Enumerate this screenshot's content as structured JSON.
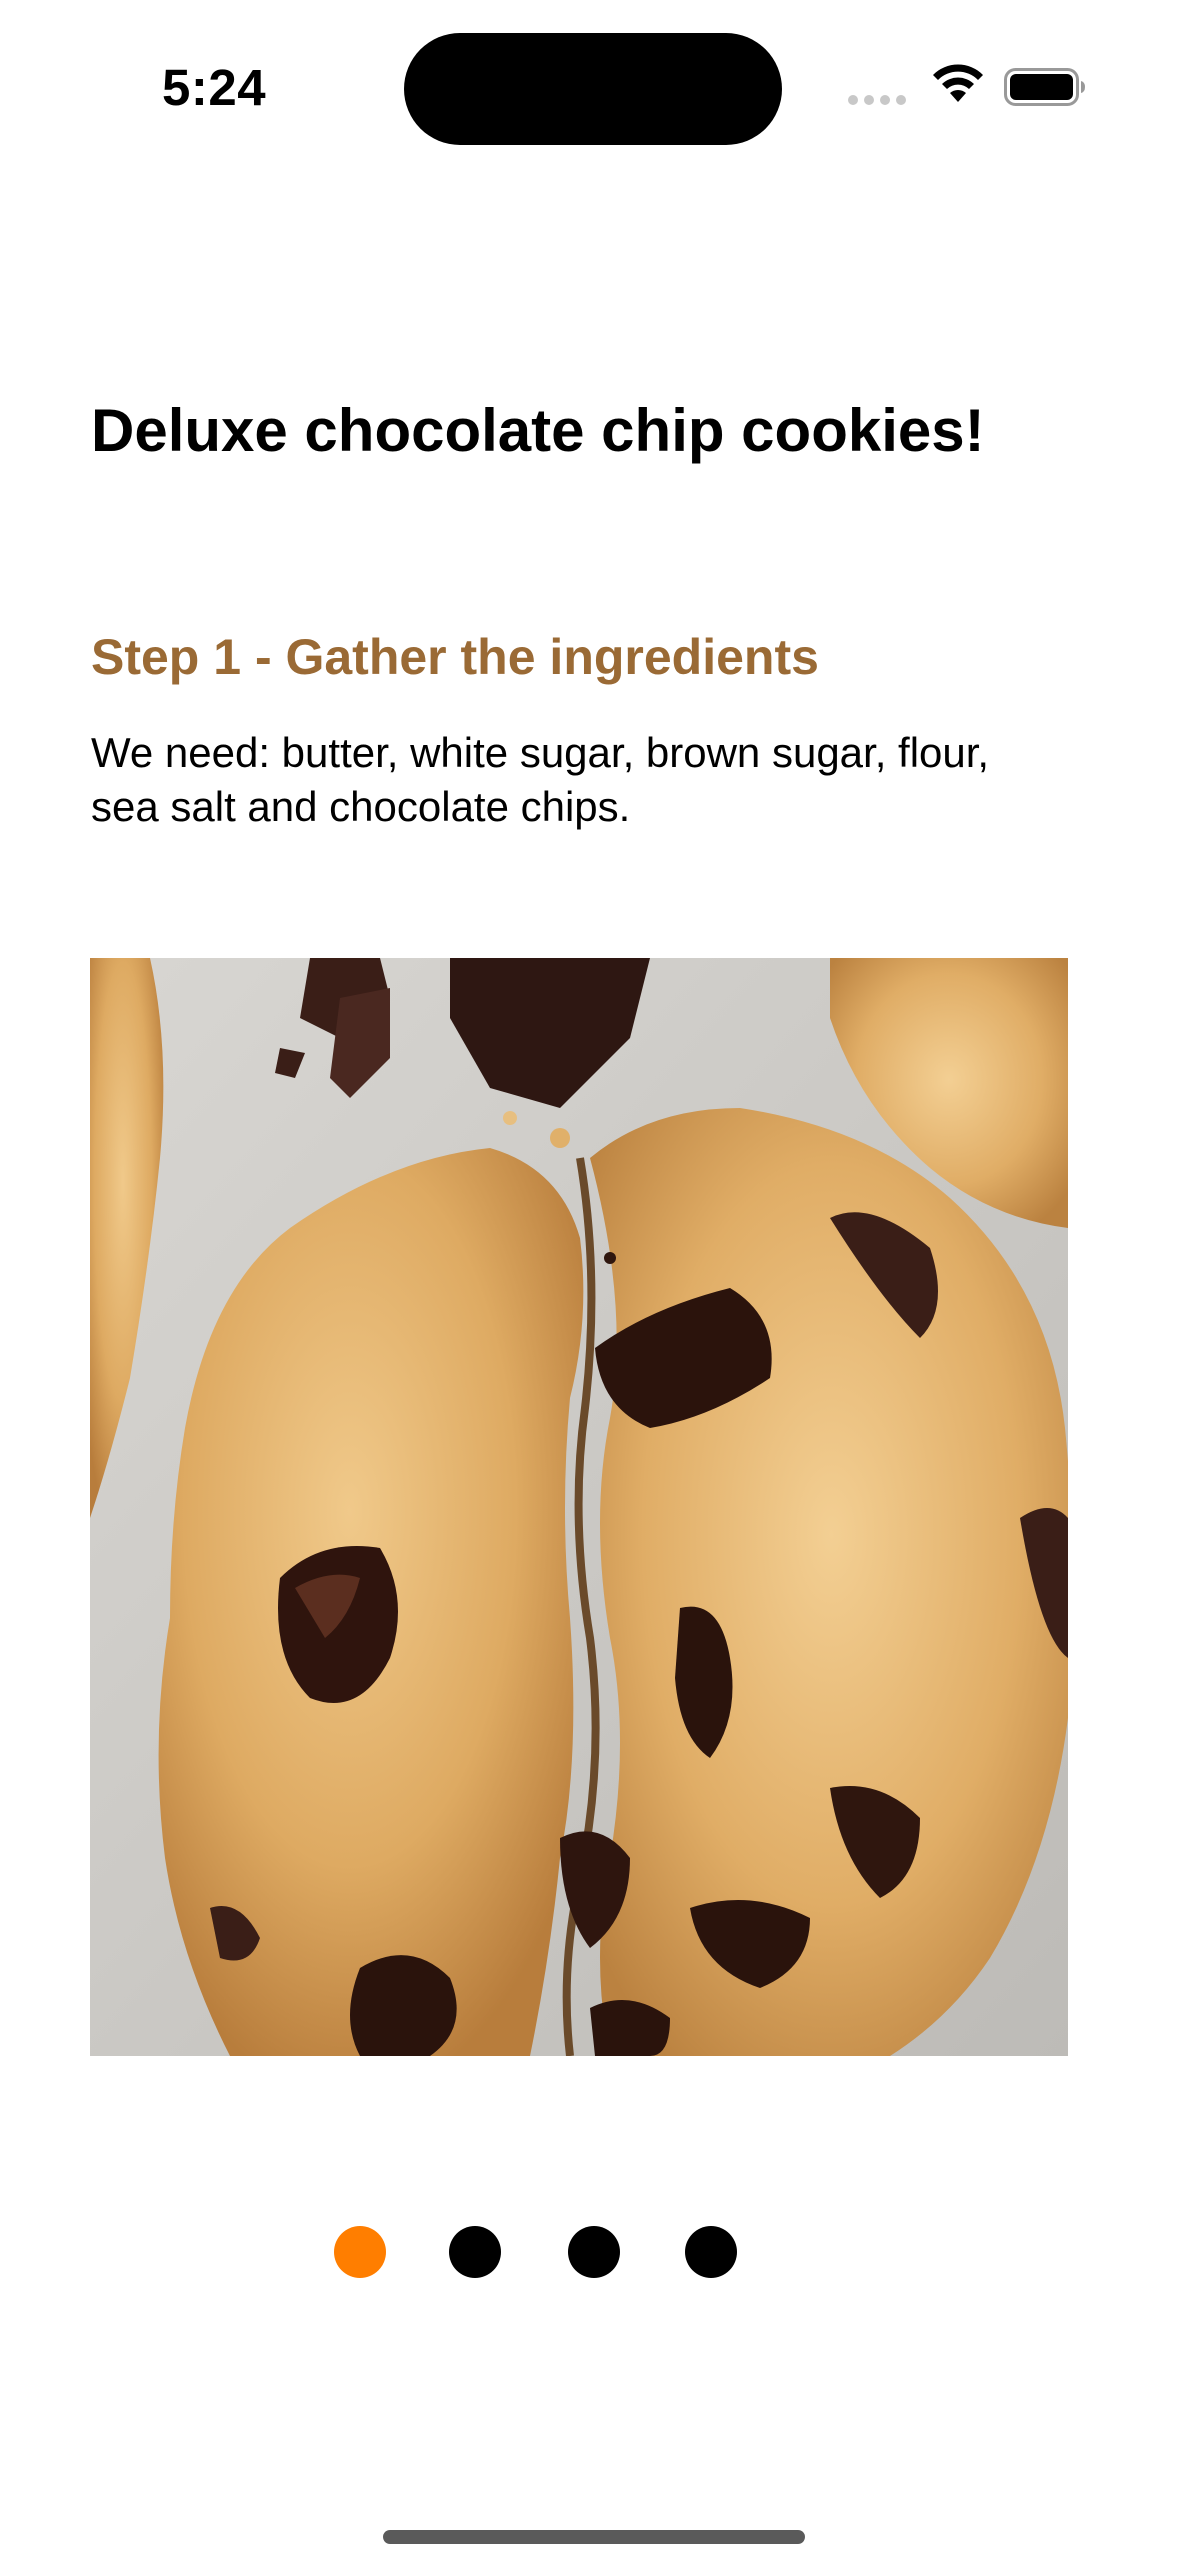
{
  "status_bar": {
    "time": "5:24",
    "icons": [
      "cellular-signal-icon",
      "wifi-icon",
      "battery-icon"
    ]
  },
  "recipe": {
    "title": "Deluxe chocolate chip cookies!",
    "step": {
      "title": "Step 1 - Gather the ingredients",
      "body_line1": "We need: butter, white sugar, brown sugar, flour,",
      "body_line2": "sea salt and chocolate chips."
    },
    "image_subject": "broken chocolate chip cookies on grey surface"
  },
  "pager": {
    "page_count": 4,
    "current_page": 1
  },
  "colors": {
    "step_title": "#9a6a35",
    "active_dot": "#ff7e00",
    "inactive_dot": "#000000"
  }
}
